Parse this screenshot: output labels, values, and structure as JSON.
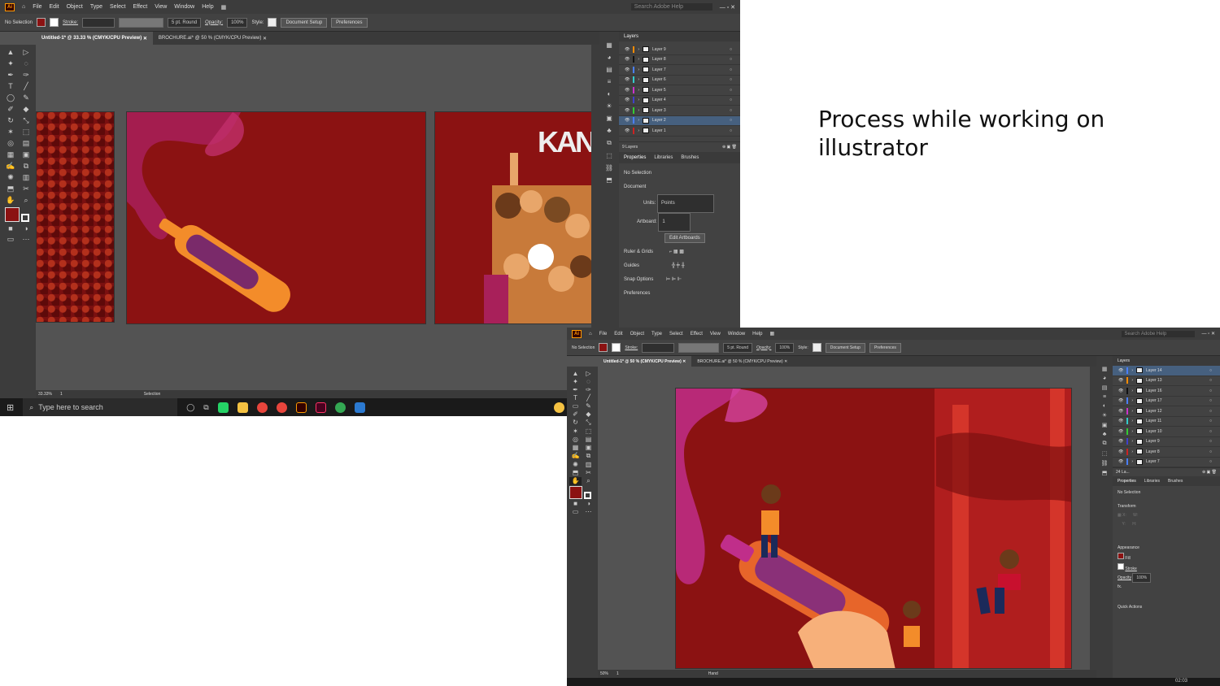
{
  "caption": "Process while working on illustrator",
  "w1": {
    "menu": [
      "File",
      "Edit",
      "Object",
      "Type",
      "Select",
      "Effect",
      "View",
      "Window",
      "Help"
    ],
    "search_placeholder": "Search Adobe Help",
    "control": {
      "selection": "No Selection",
      "stroke": "Stroke:",
      "brush": "5 pt. Round",
      "opacity_label": "Opacity:",
      "opacity": "100%",
      "style": "Style:",
      "doc_setup": "Document Setup",
      "prefs": "Preferences"
    },
    "tabs": [
      "Untitled-1* @ 33.33 % (CMYK/CPU Preview)",
      "BROCHURE.ai* @ 50 % (CMYK/CPU Preview)"
    ],
    "art_text": "KAN",
    "layers_title": "Layers",
    "layers": [
      "Layer 9",
      "Layer 8",
      "Layer 7",
      "Layer 6",
      "Layer 5",
      "Layer 4",
      "Layer 3",
      "Layer 2",
      "Layer 1"
    ],
    "layer_colors": [
      "#ff8c00",
      "#111111",
      "#4a7fff",
      "#33cccc",
      "#cc33cc",
      "#4040cc",
      "#33cc33",
      "#4a7fff",
      "#cc2222"
    ],
    "layers_count": "9 Layers",
    "panel_tabs": [
      "Properties",
      "Libraries",
      "Brushes"
    ],
    "props": {
      "nosel": "No Selection",
      "doc": "Document",
      "units_label": "Units:",
      "units": "Points",
      "artboard_label": "Artboard:",
      "artboard": "1",
      "edit": "Edit Artboards",
      "ruler": "Ruler & Grids",
      "guides": "Guides",
      "snap": "Snap Options",
      "prefs": "Preferences"
    },
    "status": {
      "zoom": "33.33%",
      "page": "1",
      "tool": "Selection"
    }
  },
  "taskbar": {
    "search": "Type here to search"
  },
  "w2": {
    "menu": [
      "File",
      "Edit",
      "Object",
      "Type",
      "Select",
      "Effect",
      "View",
      "Window",
      "Help"
    ],
    "search_placeholder": "Search Adobe Help",
    "control": {
      "selection": "No Selection",
      "stroke": "Stroke:",
      "brush": "5 pt. Round",
      "opacity_label": "Opacity:",
      "opacity": "100%",
      "style": "Style:",
      "doc_setup": "Document Setup",
      "prefs": "Preferences"
    },
    "tabs": [
      "Untitled-1* @ 50 % (CMYK/CPU Preview)",
      "BROCHURE.ai* @ 50 % (CMYK/CPU Preview)"
    ],
    "layers_title": "Layers",
    "layers": [
      "Layer 14",
      "Layer 13",
      "Layer 16",
      "Layer 17",
      "Layer 12",
      "Layer 11",
      "Layer 10",
      "Layer 9",
      "Layer 8",
      "Layer 7"
    ],
    "layer_colors": [
      "#4a7fff",
      "#ff8c00",
      "#111111",
      "#4a7fff",
      "#cc33cc",
      "#33cccc",
      "#33cc33",
      "#4040cc",
      "#cc2222",
      "#4a7fff"
    ],
    "layers_count": "24 La...",
    "panel_tabs": [
      "Properties",
      "Libraries",
      "Brushes"
    ],
    "props": {
      "nosel": "No Selection",
      "transform": "Transform",
      "appearance": "Appearance",
      "fill": "Fill",
      "stroke": "Stroke",
      "opacity_label": "Opacity",
      "opacity": "100%",
      "fx": "fx.",
      "quick": "Quick Actions"
    },
    "status": {
      "zoom": "50%",
      "page": "1",
      "tool": "Hand"
    },
    "time": "02:03"
  }
}
